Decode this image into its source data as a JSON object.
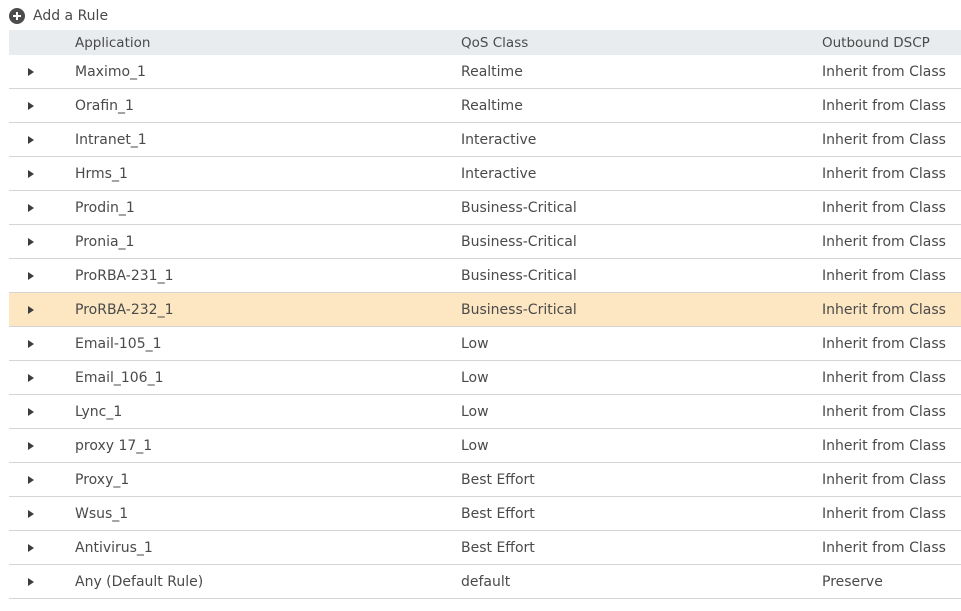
{
  "toolbar": {
    "add_rule_label": "Add a Rule",
    "add_rule_icon": "plus-circle-icon"
  },
  "table": {
    "columns": {
      "application": "Application",
      "qos_class": "QoS Class",
      "outbound_dscp": "Outbound DSCP"
    },
    "selected_row_color": "#fde7c3",
    "header_color": "#e9ecef",
    "rows": [
      {
        "application": "Maximo_1",
        "qos_class": "Realtime",
        "outbound_dscp": "Inherit from Class"
      },
      {
        "application": "Orafin_1",
        "qos_class": "Realtime",
        "outbound_dscp": "Inherit from Class"
      },
      {
        "application": "Intranet_1",
        "qos_class": "Interactive",
        "outbound_dscp": "Inherit from Class"
      },
      {
        "application": "Hrms_1",
        "qos_class": "Interactive",
        "outbound_dscp": "Inherit from Class"
      },
      {
        "application": "Prodin_1",
        "qos_class": "Business-Critical",
        "outbound_dscp": "Inherit from Class"
      },
      {
        "application": "Pronia_1",
        "qos_class": "Business-Critical",
        "outbound_dscp": "Inherit from Class"
      },
      {
        "application": "ProRBA-231_1",
        "qos_class": "Business-Critical",
        "outbound_dscp": "Inherit from Class"
      },
      {
        "application": "ProRBA-232_1",
        "qos_class": "Business-Critical",
        "outbound_dscp": "Inherit from Class",
        "selected": true
      },
      {
        "application": "Email-105_1",
        "qos_class": "Low",
        "outbound_dscp": "Inherit from Class"
      },
      {
        "application": "Email_106_1",
        "qos_class": "Low",
        "outbound_dscp": "Inherit from Class"
      },
      {
        "application": "Lync_1",
        "qos_class": "Low",
        "outbound_dscp": "Inherit from Class"
      },
      {
        "application": "proxy 17_1",
        "qos_class": "Low",
        "outbound_dscp": "Inherit from Class"
      },
      {
        "application": "Proxy_1",
        "qos_class": "Best Effort",
        "outbound_dscp": "Inherit from Class"
      },
      {
        "application": "Wsus_1",
        "qos_class": "Best Effort",
        "outbound_dscp": "Inherit from Class"
      },
      {
        "application": "Antivirus_1",
        "qos_class": "Best Effort",
        "outbound_dscp": "Inherit from Class"
      },
      {
        "application": "Any (Default Rule)",
        "qos_class": "default",
        "outbound_dscp": "Preserve"
      }
    ]
  }
}
